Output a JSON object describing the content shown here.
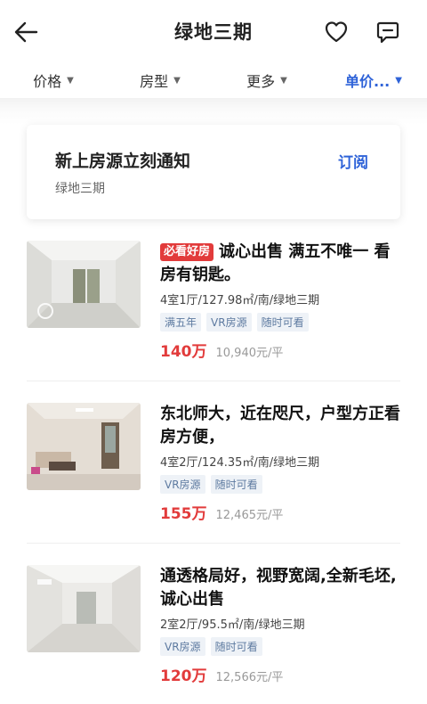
{
  "header": {
    "title": "绿地三期",
    "back_icon": "arrow-left-icon",
    "favorite_icon": "heart-icon",
    "message_icon": "message-icon"
  },
  "filters": [
    {
      "label": "价格",
      "active": false
    },
    {
      "label": "房型",
      "active": false
    },
    {
      "label": "更多",
      "active": false
    },
    {
      "label": "单价...",
      "active": true
    }
  ],
  "subscribe": {
    "title": "新上房源立刻通知",
    "subtitle": "绿地三期",
    "button": "订阅"
  },
  "listings": [
    {
      "badge": "必看好房",
      "title": "诚心出售 满五不唯一 看房有钥匙。",
      "desc": "4室1厅/127.98㎡/南/绿地三期",
      "tags": [
        "满五年",
        "VR房源",
        "随时可看"
      ],
      "price": "140万",
      "unit_price": "10,940元/平"
    },
    {
      "badge": "",
      "title": "东北师大，近在咫尺，户型方正看房方便，",
      "desc": "4室2厅/124.35㎡/南/绿地三期",
      "tags": [
        "VR房源",
        "随时可看"
      ],
      "price": "155万",
      "unit_price": "12,465元/平"
    },
    {
      "badge": "",
      "title": "通透格局好，视野宽阔,全新毛坯,诚心出售",
      "desc": "2室2厅/95.5㎡/南/绿地三期",
      "tags": [
        "VR房源",
        "随时可看"
      ],
      "price": "120万",
      "unit_price": "12,566元/平"
    }
  ],
  "colors": {
    "accent": "#2f63d8",
    "price": "#e23b3b",
    "tag_bg": "#eef2f7",
    "tag_text": "#5d7aa0"
  }
}
